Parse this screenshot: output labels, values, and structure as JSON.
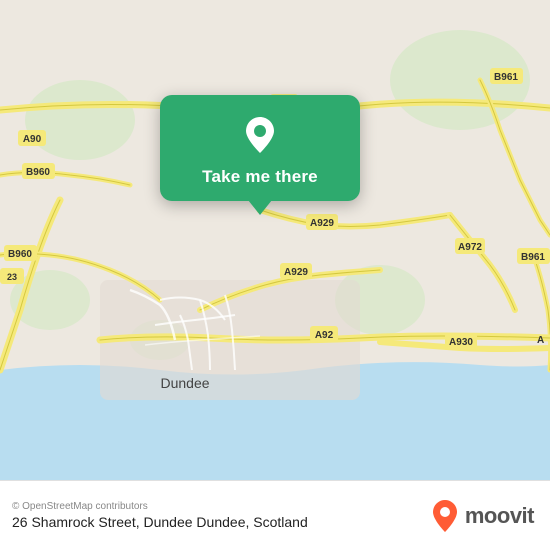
{
  "map": {
    "background_color": "#e8e0d8",
    "water_color": "#b8ddf0",
    "road_color": "#f5e97a",
    "road_stroke": "#e8d850"
  },
  "popup": {
    "label": "Take me there",
    "background": "#2eaa6e",
    "pin_color": "#fff"
  },
  "bottom_bar": {
    "copyright": "© OpenStreetMap contributors",
    "address": "26 Shamrock Street, Dundee Dundee, Scotland",
    "moovit_label": "moovit"
  },
  "road_labels": [
    {
      "id": "A90_top",
      "text": "A90"
    },
    {
      "id": "A90_left",
      "text": "A90"
    },
    {
      "id": "B960_top",
      "text": "B960"
    },
    {
      "id": "B960_bottom",
      "text": "B960"
    },
    {
      "id": "B961_top",
      "text": "B961"
    },
    {
      "id": "B961_bottom",
      "text": "B961"
    },
    {
      "id": "A972",
      "text": "A972"
    },
    {
      "id": "A929_top",
      "text": "A929"
    },
    {
      "id": "A929_bottom",
      "text": "A929"
    },
    {
      "id": "A92",
      "text": "A92"
    },
    {
      "id": "A930",
      "text": "A930"
    },
    {
      "id": "dundee",
      "text": "Dundee"
    }
  ]
}
